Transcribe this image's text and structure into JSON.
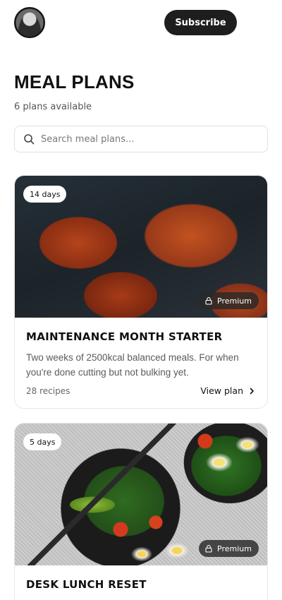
{
  "header": {
    "subscribe_label": "Subscribe"
  },
  "page": {
    "title": "MEAL PLANS",
    "subtitle": "6 plans available"
  },
  "search": {
    "placeholder": "Search meal plans...",
    "value": ""
  },
  "plans": [
    {
      "duration": "14 days",
      "tier": "Premium",
      "title": "MAINTENANCE MONTH STARTER",
      "description": "Two weeks of 2500kcal balanced meals. For when you're done cutting but not bulking yet.",
      "recipes": "28 recipes",
      "cta": "View plan",
      "image": "grilled-chicken-photo"
    },
    {
      "duration": "5 days",
      "tier": "Premium",
      "title": "DESK LUNCH RESET",
      "image": "meal-prep-salad-photo"
    }
  ],
  "icons": {
    "search": "search-icon",
    "lock": "lock-icon",
    "chevron": "chevron-right-icon",
    "avatar": "user-avatar"
  },
  "colors": {
    "button_bg": "#1e1e1e",
    "badge_dark": "#282828",
    "border": "#e6e6e6"
  }
}
